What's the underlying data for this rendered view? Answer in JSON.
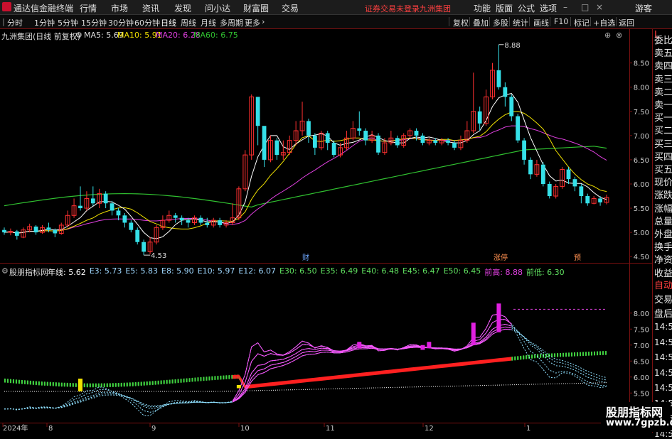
{
  "titlebar": {
    "app_name": "通达信金融终端",
    "menus": [
      "行情",
      "市场",
      "资讯",
      "发现",
      "问小达",
      "财富圈",
      "交易"
    ],
    "warning": "证券交易未登录",
    "stock_name": "九洲集团",
    "right_menus": [
      "功能",
      "版面",
      "公式",
      "选项"
    ],
    "guest": "游客"
  },
  "toolbar": {
    "periods": [
      "分时",
      "1分钟",
      "5分钟",
      "15分钟",
      "30分钟",
      "60分钟",
      "日线",
      "周线",
      "月线",
      "多周期",
      "更多"
    ],
    "active_period": "日线",
    "tools": [
      "复权",
      "叠加",
      "多股",
      "统计",
      "画线",
      "F10",
      "标记",
      "+自选",
      "返回"
    ]
  },
  "right_panel": {
    "top_label": "L",
    "items": [
      "委比",
      "卖五",
      "卖四",
      "卖三",
      "卖二",
      "卖一",
      "买一",
      "买二",
      "买三",
      "买四",
      "买五",
      "现价",
      "涨跌",
      "涨幅",
      "总量",
      "外盘",
      "换手",
      "净资",
      "收益",
      "自动",
      "交易",
      "盘后"
    ],
    "times": [
      "14:5",
      "14:5",
      "14:5",
      "14:5",
      "14:5",
      "14:5",
      "14:5",
      "14:5"
    ]
  },
  "main_chart": {
    "title": "九洲集团(日线 前复权)",
    "ma": [
      {
        "label": "MA5: 5.69",
        "color": "#ffffff"
      },
      {
        "label": "MA10: 5.91",
        "color": "#f0e000"
      },
      {
        "label": "MA20: 6.28",
        "color": "#e040e0"
      },
      {
        "label": "MA60: 6.75",
        "color": "#30c030"
      }
    ],
    "yticks": [
      "8.50",
      "8.00",
      "7.50",
      "7.00",
      "6.50",
      "6.00",
      "5.50",
      "5.00",
      "4.50"
    ],
    "high_label": "8.88",
    "low_label": "4.53",
    "markers": [
      "财",
      "涨停",
      "预"
    ]
  },
  "indicator": {
    "name": "股朋指标网",
    "items": [
      {
        "label": "年线: 5.62",
        "color": "#ffffff"
      },
      {
        "label": "E3: 5.73",
        "color": "#9fd8ff"
      },
      {
        "label": "E5: 5.83",
        "color": "#9fd8ff"
      },
      {
        "label": "E8: 5.90",
        "color": "#9fd8ff"
      },
      {
        "label": "E10: 5.97",
        "color": "#9fd8ff"
      },
      {
        "label": "E12: 6.07",
        "color": "#9fd8ff"
      },
      {
        "label": "E30: 6.50",
        "color": "#60e060"
      },
      {
        "label": "E35: 6.49",
        "color": "#60e060"
      },
      {
        "label": "E40: 6.48",
        "color": "#60e060"
      },
      {
        "label": "E45: 6.47",
        "color": "#60e060"
      },
      {
        "label": "E50: 6.45",
        "color": "#60e060"
      },
      {
        "label": "前高: 8.88",
        "color": "#e040e0"
      },
      {
        "label": "前低: 6.30",
        "color": "#60e060"
      }
    ],
    "yticks": [
      "8.00",
      "7.50",
      "7.00",
      "6.50",
      "6.00",
      "5.50"
    ]
  },
  "xaxis": {
    "labels": [
      "2024年",
      "8",
      "9",
      "10",
      "11",
      "12",
      "1"
    ]
  },
  "watermark": {
    "line1": "股朋指标网",
    "line2": "www.7gpzb.com"
  },
  "colors": {
    "up": "#ff3030",
    "down": "#35e0e8",
    "frame": "#7a1010",
    "accent": "#d4a017"
  },
  "chart_data": {
    "type": "candlestick",
    "title": "九洲集团(日线 前复权)",
    "ylim": [
      4.4,
      8.95
    ],
    "candles": [
      [
        5.05,
        5.0,
        5.1,
        4.95
      ],
      [
        5.0,
        5.02,
        5.08,
        4.94
      ],
      [
        5.02,
        4.93,
        5.05,
        4.85
      ],
      [
        4.9,
        5.05,
        5.1,
        4.88
      ],
      [
        5.05,
        5.12,
        5.18,
        5.0
      ],
      [
        5.12,
        5.0,
        5.15,
        4.95
      ],
      [
        5.0,
        5.1,
        5.15,
        4.97
      ],
      [
        5.1,
        5.05,
        5.2,
        5.0
      ],
      [
        5.05,
        4.98,
        5.08,
        4.9
      ],
      [
        4.98,
        5.15,
        5.2,
        4.95
      ],
      [
        5.15,
        5.35,
        5.45,
        5.1
      ],
      [
        5.35,
        5.55,
        5.7,
        5.3
      ],
      [
        5.55,
        5.5,
        5.95,
        5.45
      ],
      [
        5.5,
        5.7,
        5.85,
        5.45
      ],
      [
        5.7,
        5.6,
        5.95,
        5.55
      ],
      [
        5.6,
        5.8,
        5.9,
        5.5
      ],
      [
        5.8,
        5.6,
        5.85,
        5.5
      ],
      [
        5.6,
        5.45,
        5.65,
        5.35
      ],
      [
        5.45,
        5.35,
        5.5,
        5.25
      ],
      [
        5.35,
        5.2,
        5.4,
        5.1
      ],
      [
        5.2,
        5.05,
        5.25,
        5.0
      ],
      [
        5.05,
        4.8,
        5.1,
        4.75
      ],
      [
        4.8,
        4.6,
        4.85,
        4.53
      ],
      [
        4.6,
        4.8,
        4.9,
        4.55
      ],
      [
        4.8,
        5.1,
        5.15,
        4.75
      ],
      [
        5.1,
        5.25,
        5.35,
        5.05
      ],
      [
        5.25,
        5.35,
        5.45,
        5.2
      ],
      [
        5.35,
        5.3,
        5.4,
        5.2
      ],
      [
        5.3,
        5.25,
        5.35,
        5.15
      ],
      [
        5.25,
        5.2,
        5.3,
        5.1
      ],
      [
        5.2,
        5.3,
        5.35,
        5.15
      ],
      [
        5.3,
        5.2,
        5.35,
        5.15
      ],
      [
        5.2,
        5.15,
        5.3,
        5.1
      ],
      [
        5.15,
        5.25,
        5.3,
        5.1
      ],
      [
        5.25,
        5.15,
        5.3,
        5.1
      ],
      [
        5.15,
        5.2,
        5.25,
        5.1
      ],
      [
        5.2,
        5.3,
        5.6,
        5.15
      ],
      [
        5.3,
        5.9,
        5.95,
        5.25
      ],
      [
        5.9,
        6.6,
        6.7,
        5.85
      ],
      [
        6.6,
        7.8,
        7.85,
        6.5
      ],
      [
        7.8,
        7.2,
        7.6,
        6.8
      ],
      [
        7.2,
        6.5,
        7.0,
        6.35
      ],
      [
        6.5,
        6.9,
        7.0,
        6.45
      ],
      [
        6.9,
        6.6,
        6.95,
        6.5
      ],
      [
        6.6,
        6.65,
        6.9,
        6.5
      ],
      [
        6.65,
        6.9,
        7.0,
        6.6
      ],
      [
        6.9,
        7.1,
        7.3,
        6.8
      ],
      [
        7.1,
        7.3,
        7.7,
        7.0
      ],
      [
        7.3,
        7.0,
        7.35,
        6.85
      ],
      [
        7.0,
        6.75,
        7.05,
        6.6
      ],
      [
        6.75,
        7.05,
        7.1,
        6.7
      ],
      [
        7.05,
        6.85,
        7.1,
        6.7
      ],
      [
        6.85,
        6.6,
        6.9,
        6.55
      ],
      [
        6.6,
        6.75,
        6.85,
        6.55
      ],
      [
        6.75,
        6.95,
        7.1,
        6.7
      ],
      [
        6.95,
        7.15,
        7.3,
        6.9
      ],
      [
        7.15,
        7.1,
        7.5,
        7.0
      ],
      [
        7.1,
        6.9,
        7.15,
        6.8
      ],
      [
        6.9,
        7.0,
        7.1,
        6.85
      ],
      [
        7.0,
        6.65,
        7.05,
        6.6
      ],
      [
        6.65,
        6.85,
        6.95,
        6.6
      ],
      [
        6.85,
        6.95,
        7.1,
        6.8
      ],
      [
        6.95,
        6.8,
        7.0,
        6.75
      ],
      [
        6.8,
        7.0,
        7.05,
        6.75
      ],
      [
        7.0,
        7.1,
        7.15,
        6.95
      ],
      [
        7.1,
        7.0,
        7.15,
        6.9
      ],
      [
        7.0,
        6.85,
        7.05,
        6.8
      ],
      [
        6.85,
        6.9,
        6.95,
        6.8
      ],
      [
        6.9,
        6.85,
        6.95,
        6.8
      ],
      [
        6.85,
        6.9,
        6.95,
        6.8
      ],
      [
        6.9,
        6.85,
        6.95,
        6.8
      ],
      [
        6.85,
        6.75,
        6.9,
        6.7
      ],
      [
        6.75,
        6.9,
        7.0,
        6.7
      ],
      [
        6.9,
        7.1,
        7.3,
        6.85
      ],
      [
        7.1,
        7.5,
        8.3,
        7.05
      ],
      [
        7.5,
        7.25,
        7.6,
        7.1
      ],
      [
        7.25,
        7.8,
        7.95,
        7.2
      ],
      [
        7.8,
        8.35,
        8.5,
        7.75
      ],
      [
        8.35,
        8.0,
        8.88,
        7.95
      ],
      [
        8.0,
        7.8,
        8.1,
        7.6
      ],
      [
        7.8,
        7.4,
        7.85,
        7.3
      ],
      [
        7.4,
        6.9,
        7.45,
        6.85
      ],
      [
        6.9,
        6.5,
        6.95,
        6.4
      ],
      [
        6.5,
        6.2,
        6.55,
        6.1
      ],
      [
        6.2,
        6.4,
        6.5,
        6.15
      ],
      [
        6.4,
        6.0,
        6.45,
        5.95
      ],
      [
        6.0,
        5.75,
        6.05,
        5.7
      ],
      [
        5.75,
        5.95,
        6.0,
        5.7
      ],
      [
        5.95,
        6.3,
        6.35,
        5.9
      ],
      [
        6.3,
        6.1,
        6.35,
        6.0
      ],
      [
        6.1,
        5.95,
        6.15,
        5.85
      ],
      [
        5.95,
        5.75,
        6.0,
        5.6
      ],
      [
        5.75,
        5.6,
        5.8,
        5.55
      ],
      [
        5.6,
        5.7,
        5.75,
        5.58
      ],
      [
        5.7,
        5.62,
        5.75,
        5.55
      ],
      [
        5.62,
        5.72,
        5.78,
        5.58
      ]
    ]
  }
}
